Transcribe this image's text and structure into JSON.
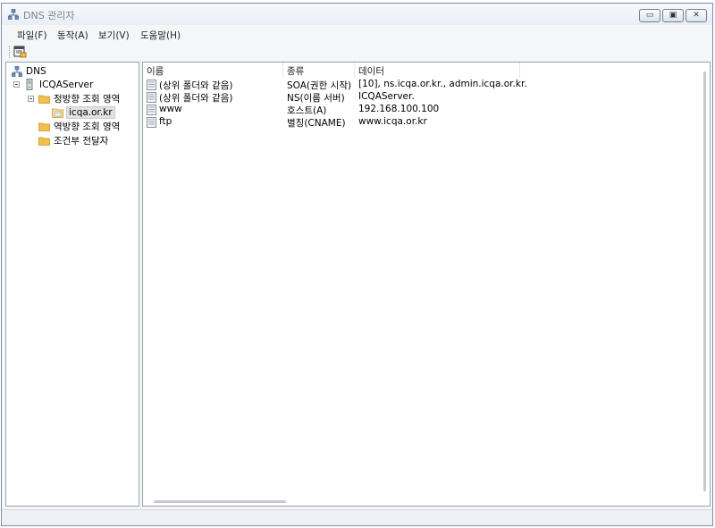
{
  "window": {
    "title": "DNS 관리자",
    "buttons": {
      "minimize": "▭",
      "maximize": "▣",
      "close": "✕"
    }
  },
  "menu": [
    {
      "label": "파일(F)"
    },
    {
      "label": "동작(A)"
    },
    {
      "label": "보기(V)"
    },
    {
      "label": "도움말(H)"
    }
  ],
  "tree": {
    "root": "DNS",
    "server": "ICQAServer",
    "forward_zones": "정방향 조회 영역",
    "zone": "icqa.or.kr",
    "reverse_zones": "역방향 조회 영역",
    "forwarders": "조건부 전달자"
  },
  "list": {
    "columns": [
      "이름",
      "종류",
      "데이터"
    ],
    "rows": [
      {
        "name": "(상위 폴더와 같음)",
        "type": "SOA(권한 시작)",
        "data": "[10], ns.icqa.or.kr., admin.icqa.or.kr."
      },
      {
        "name": "(상위 폴더와 같음)",
        "type": "NS(이름 서버)",
        "data": "ICQAServer."
      },
      {
        "name": "www",
        "type": "호스트(A)",
        "data": "192.168.100.100"
      },
      {
        "name": "ftp",
        "type": "별칭(CNAME)",
        "data": "www.icqa.or.kr"
      }
    ]
  },
  "colors": {
    "accent": "#3c7fb1",
    "folder": "#f3c04c",
    "selection": "#e2e2e2"
  }
}
